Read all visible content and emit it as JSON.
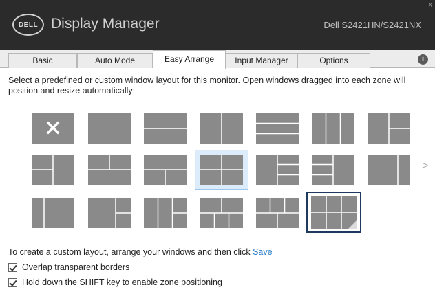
{
  "window": {
    "logo_text": "DELL",
    "app_title": "Display Manager",
    "model": "Dell S2421HN/S2421NX",
    "close_glyph": "x"
  },
  "tabs": [
    {
      "label": "Basic",
      "active": false
    },
    {
      "label": "Auto Mode",
      "active": false
    },
    {
      "label": "Easy Arrange",
      "active": true
    },
    {
      "label": "Input Manager",
      "active": false
    },
    {
      "label": "Options",
      "active": false
    }
  ],
  "info_glyph": "i",
  "description": "Select a predefined or custom window layout for this monitor.  Open windows dragged into each zone will position and resize automatically:",
  "layouts": [
    {
      "name": "none",
      "selected": false
    },
    {
      "name": "full",
      "selected": false
    },
    {
      "name": "two-rows",
      "selected": false
    },
    {
      "name": "two-columns",
      "selected": false
    },
    {
      "name": "three-rows",
      "selected": false
    },
    {
      "name": "three-columns",
      "selected": false
    },
    {
      "name": "main-left-two-right",
      "selected": false
    },
    {
      "name": "left-two-main-right",
      "selected": false
    },
    {
      "name": "top-two-bottom-one",
      "selected": false
    },
    {
      "name": "top-one-bottom-two",
      "selected": false
    },
    {
      "name": "grid-2x2",
      "selected": true
    },
    {
      "name": "main-left-three-right",
      "selected": false
    },
    {
      "name": "three-left-main-right",
      "selected": false
    },
    {
      "name": "main-left-narrow-right",
      "selected": false
    },
    {
      "name": "narrow-left-main-right",
      "selected": false
    },
    {
      "name": "main-left-grid-right",
      "selected": false
    },
    {
      "name": "three-cols-split-right",
      "selected": false
    },
    {
      "name": "grid-2x3",
      "selected": false
    },
    {
      "name": "grid-3x2",
      "selected": false
    },
    {
      "name": "custom-2x3",
      "selected": false
    }
  ],
  "next_glyph": ">",
  "custom_text": "To create a custom layout, arrange your windows and then click",
  "save_label": "Save",
  "options": [
    {
      "label": "Overlap transparent borders",
      "checked": true
    },
    {
      "label": "Hold down the SHIFT key to enable zone positioning",
      "checked": true
    }
  ]
}
